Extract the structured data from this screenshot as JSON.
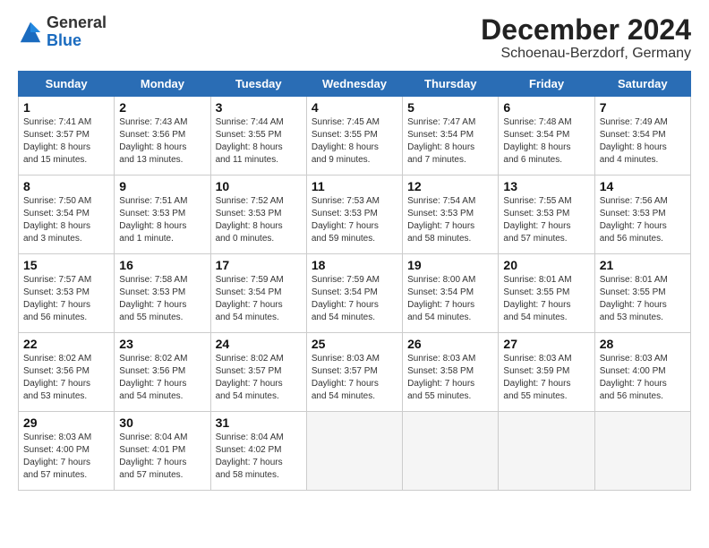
{
  "logo": {
    "general": "General",
    "blue": "Blue"
  },
  "header": {
    "month": "December 2024",
    "location": "Schoenau-Berzdorf, Germany"
  },
  "weekdays": [
    "Sunday",
    "Monday",
    "Tuesday",
    "Wednesday",
    "Thursday",
    "Friday",
    "Saturday"
  ],
  "weeks": [
    [
      {
        "day": "1",
        "lines": [
          "Sunrise: 7:41 AM",
          "Sunset: 3:57 PM",
          "Daylight: 8 hours",
          "and 15 minutes."
        ]
      },
      {
        "day": "2",
        "lines": [
          "Sunrise: 7:43 AM",
          "Sunset: 3:56 PM",
          "Daylight: 8 hours",
          "and 13 minutes."
        ]
      },
      {
        "day": "3",
        "lines": [
          "Sunrise: 7:44 AM",
          "Sunset: 3:55 PM",
          "Daylight: 8 hours",
          "and 11 minutes."
        ]
      },
      {
        "day": "4",
        "lines": [
          "Sunrise: 7:45 AM",
          "Sunset: 3:55 PM",
          "Daylight: 8 hours",
          "and 9 minutes."
        ]
      },
      {
        "day": "5",
        "lines": [
          "Sunrise: 7:47 AM",
          "Sunset: 3:54 PM",
          "Daylight: 8 hours",
          "and 7 minutes."
        ]
      },
      {
        "day": "6",
        "lines": [
          "Sunrise: 7:48 AM",
          "Sunset: 3:54 PM",
          "Daylight: 8 hours",
          "and 6 minutes."
        ]
      },
      {
        "day": "7",
        "lines": [
          "Sunrise: 7:49 AM",
          "Sunset: 3:54 PM",
          "Daylight: 8 hours",
          "and 4 minutes."
        ]
      }
    ],
    [
      {
        "day": "8",
        "lines": [
          "Sunrise: 7:50 AM",
          "Sunset: 3:54 PM",
          "Daylight: 8 hours",
          "and 3 minutes."
        ]
      },
      {
        "day": "9",
        "lines": [
          "Sunrise: 7:51 AM",
          "Sunset: 3:53 PM",
          "Daylight: 8 hours",
          "and 1 minute."
        ]
      },
      {
        "day": "10",
        "lines": [
          "Sunrise: 7:52 AM",
          "Sunset: 3:53 PM",
          "Daylight: 8 hours",
          "and 0 minutes."
        ]
      },
      {
        "day": "11",
        "lines": [
          "Sunrise: 7:53 AM",
          "Sunset: 3:53 PM",
          "Daylight: 7 hours",
          "and 59 minutes."
        ]
      },
      {
        "day": "12",
        "lines": [
          "Sunrise: 7:54 AM",
          "Sunset: 3:53 PM",
          "Daylight: 7 hours",
          "and 58 minutes."
        ]
      },
      {
        "day": "13",
        "lines": [
          "Sunrise: 7:55 AM",
          "Sunset: 3:53 PM",
          "Daylight: 7 hours",
          "and 57 minutes."
        ]
      },
      {
        "day": "14",
        "lines": [
          "Sunrise: 7:56 AM",
          "Sunset: 3:53 PM",
          "Daylight: 7 hours",
          "and 56 minutes."
        ]
      }
    ],
    [
      {
        "day": "15",
        "lines": [
          "Sunrise: 7:57 AM",
          "Sunset: 3:53 PM",
          "Daylight: 7 hours",
          "and 56 minutes."
        ]
      },
      {
        "day": "16",
        "lines": [
          "Sunrise: 7:58 AM",
          "Sunset: 3:53 PM",
          "Daylight: 7 hours",
          "and 55 minutes."
        ]
      },
      {
        "day": "17",
        "lines": [
          "Sunrise: 7:59 AM",
          "Sunset: 3:54 PM",
          "Daylight: 7 hours",
          "and 54 minutes."
        ]
      },
      {
        "day": "18",
        "lines": [
          "Sunrise: 7:59 AM",
          "Sunset: 3:54 PM",
          "Daylight: 7 hours",
          "and 54 minutes."
        ]
      },
      {
        "day": "19",
        "lines": [
          "Sunrise: 8:00 AM",
          "Sunset: 3:54 PM",
          "Daylight: 7 hours",
          "and 54 minutes."
        ]
      },
      {
        "day": "20",
        "lines": [
          "Sunrise: 8:01 AM",
          "Sunset: 3:55 PM",
          "Daylight: 7 hours",
          "and 54 minutes."
        ]
      },
      {
        "day": "21",
        "lines": [
          "Sunrise: 8:01 AM",
          "Sunset: 3:55 PM",
          "Daylight: 7 hours",
          "and 53 minutes."
        ]
      }
    ],
    [
      {
        "day": "22",
        "lines": [
          "Sunrise: 8:02 AM",
          "Sunset: 3:56 PM",
          "Daylight: 7 hours",
          "and 53 minutes."
        ]
      },
      {
        "day": "23",
        "lines": [
          "Sunrise: 8:02 AM",
          "Sunset: 3:56 PM",
          "Daylight: 7 hours",
          "and 54 minutes."
        ]
      },
      {
        "day": "24",
        "lines": [
          "Sunrise: 8:02 AM",
          "Sunset: 3:57 PM",
          "Daylight: 7 hours",
          "and 54 minutes."
        ]
      },
      {
        "day": "25",
        "lines": [
          "Sunrise: 8:03 AM",
          "Sunset: 3:57 PM",
          "Daylight: 7 hours",
          "and 54 minutes."
        ]
      },
      {
        "day": "26",
        "lines": [
          "Sunrise: 8:03 AM",
          "Sunset: 3:58 PM",
          "Daylight: 7 hours",
          "and 55 minutes."
        ]
      },
      {
        "day": "27",
        "lines": [
          "Sunrise: 8:03 AM",
          "Sunset: 3:59 PM",
          "Daylight: 7 hours",
          "and 55 minutes."
        ]
      },
      {
        "day": "28",
        "lines": [
          "Sunrise: 8:03 AM",
          "Sunset: 4:00 PM",
          "Daylight: 7 hours",
          "and 56 minutes."
        ]
      }
    ],
    [
      {
        "day": "29",
        "lines": [
          "Sunrise: 8:03 AM",
          "Sunset: 4:00 PM",
          "Daylight: 7 hours",
          "and 57 minutes."
        ]
      },
      {
        "day": "30",
        "lines": [
          "Sunrise: 8:04 AM",
          "Sunset: 4:01 PM",
          "Daylight: 7 hours",
          "and 57 minutes."
        ]
      },
      {
        "day": "31",
        "lines": [
          "Sunrise: 8:04 AM",
          "Sunset: 4:02 PM",
          "Daylight: 7 hours",
          "and 58 minutes."
        ]
      },
      {
        "day": "",
        "lines": []
      },
      {
        "day": "",
        "lines": []
      },
      {
        "day": "",
        "lines": []
      },
      {
        "day": "",
        "lines": []
      }
    ]
  ]
}
